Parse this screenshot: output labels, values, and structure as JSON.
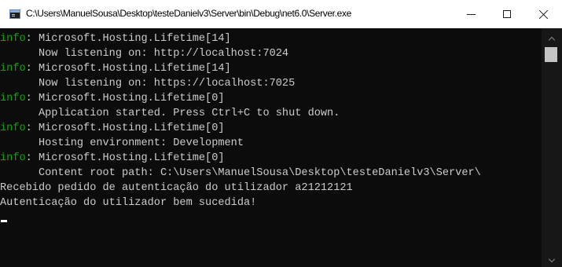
{
  "window": {
    "title": "C:\\Users\\ManuelSousa\\Desktop\\testeDanielv3\\Server\\bin\\Debug\\net6.0\\Server.exe"
  },
  "console": {
    "lines": [
      {
        "level": "info",
        "text": ": Microsoft.Hosting.Lifetime[14]"
      },
      {
        "level": "",
        "text": "      Now listening on: http://localhost:7024"
      },
      {
        "level": "info",
        "text": ": Microsoft.Hosting.Lifetime[14]"
      },
      {
        "level": "",
        "text": "      Now listening on: https://localhost:7025"
      },
      {
        "level": "info",
        "text": ": Microsoft.Hosting.Lifetime[0]"
      },
      {
        "level": "",
        "text": "      Application started. Press Ctrl+C to shut down."
      },
      {
        "level": "info",
        "text": ": Microsoft.Hosting.Lifetime[0]"
      },
      {
        "level": "",
        "text": "      Hosting environment: Development"
      },
      {
        "level": "info",
        "text": ": Microsoft.Hosting.Lifetime[0]"
      },
      {
        "level": "",
        "text": "      Content root path: C:\\Users\\ManuelSousa\\Desktop\\testeDanielv3\\Server\\"
      },
      {
        "level": "",
        "text": "Recebido pedido de autenticação do utilizador a21212121"
      },
      {
        "level": "",
        "text": "Autenticação do utilizador bem sucedida!"
      }
    ]
  },
  "colors": {
    "background": "#0c0c0c",
    "text": "#cccccc",
    "info_level": "#13a10e",
    "titlebar": "#ffffff"
  },
  "icons": {
    "app": "console-app-icon",
    "minimize": "minimize-icon",
    "maximize": "maximize-icon",
    "close": "close-icon",
    "scroll_up": "chevron-up-icon",
    "scroll_down": "chevron-down-icon"
  }
}
